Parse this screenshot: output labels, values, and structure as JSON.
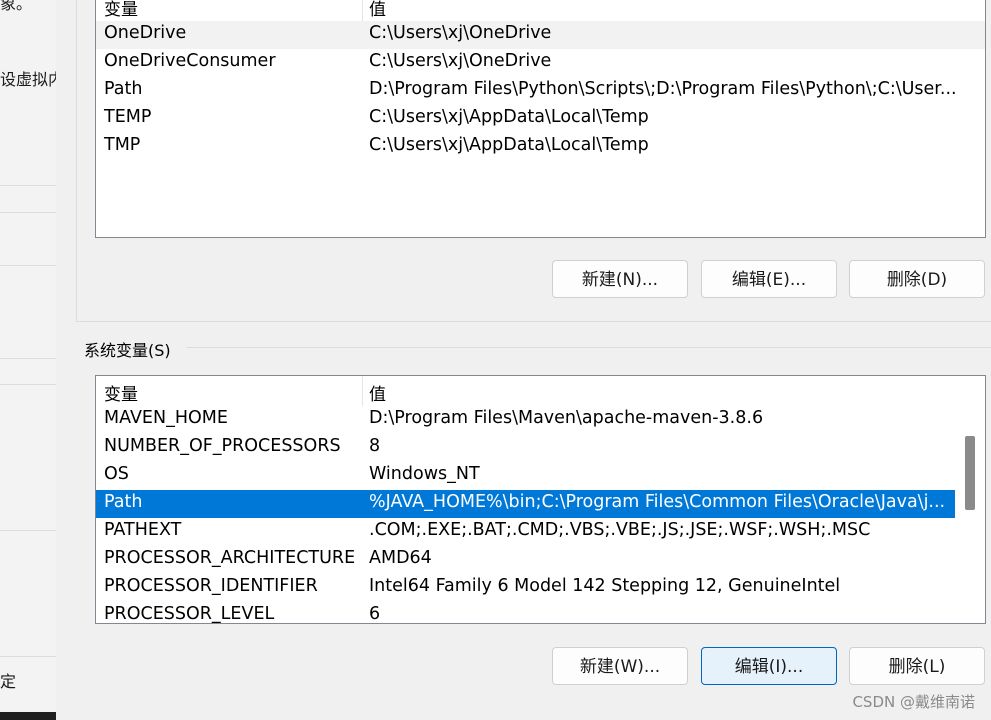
{
  "background_window": {
    "fragments": [
      "象。",
      "设虚拟内",
      "定"
    ]
  },
  "user_vars": {
    "headers": {
      "name": "变量",
      "value": "值"
    },
    "rows": [
      {
        "name": "OneDrive",
        "value": "C:\\Users\\xj\\OneDrive"
      },
      {
        "name": "OneDriveConsumer",
        "value": "C:\\Users\\xj\\OneDrive"
      },
      {
        "name": "Path",
        "value": "D:\\Program Files\\Python\\Scripts\\;D:\\Program Files\\Python\\;C:\\User..."
      },
      {
        "name": "TEMP",
        "value": "C:\\Users\\xj\\AppData\\Local\\Temp"
      },
      {
        "name": "TMP",
        "value": "C:\\Users\\xj\\AppData\\Local\\Temp"
      }
    ],
    "buttons": {
      "new": "新建(N)...",
      "edit": "编辑(E)...",
      "delete": "删除(D)"
    }
  },
  "system_vars": {
    "group_label": "系统变量(S)",
    "headers": {
      "name": "变量",
      "value": "值"
    },
    "rows": [
      {
        "name": "MAVEN_HOME",
        "value": "D:\\Program Files\\Maven\\apache-maven-3.8.6"
      },
      {
        "name": "NUMBER_OF_PROCESSORS",
        "value": "8"
      },
      {
        "name": "OS",
        "value": "Windows_NT"
      },
      {
        "name": "Path",
        "value": "%JAVA_HOME%\\bin;C:\\Program Files\\Common Files\\Oracle\\Java\\j..."
      },
      {
        "name": "PATHEXT",
        "value": ".COM;.EXE;.BAT;.CMD;.VBS;.VBE;.JS;.JSE;.WSF;.WSH;.MSC"
      },
      {
        "name": "PROCESSOR_ARCHITECTURE",
        "value": "AMD64"
      },
      {
        "name": "PROCESSOR_IDENTIFIER",
        "value": "Intel64 Family 6 Model 142 Stepping 12, GenuineIntel"
      },
      {
        "name": "PROCESSOR_LEVEL",
        "value": "6"
      }
    ],
    "selected_row": "Path",
    "buttons": {
      "new": "新建(W)...",
      "edit": "编辑(I)...",
      "delete": "删除(L)"
    }
  },
  "watermark": "CSDN @戴维南诺",
  "colors": {
    "selection": "#0078d7",
    "focus_border": "#0067c0"
  }
}
